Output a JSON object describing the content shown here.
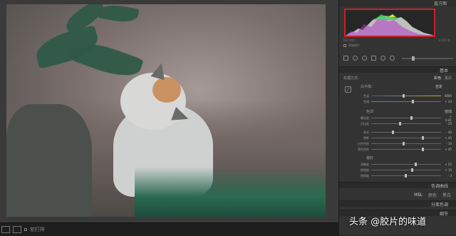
{
  "panel": {
    "header": "直方图",
    "histogram_info": {
      "left": "ISO 400",
      "right": "1/125 秒"
    },
    "original_photo": "原始照片",
    "sections": {
      "basic": "基本",
      "tone_curve": "色调曲线",
      "split_toning": "分离色调",
      "details": "细节"
    },
    "treatment": {
      "label": "处理方式：",
      "color": "彩色",
      "bw": "黑白"
    },
    "white_balance": {
      "label": "白平衡：",
      "value": "自定"
    },
    "temp": {
      "label": "色温",
      "value": "4800"
    },
    "tint": {
      "label": "色调",
      "value": "+ 24"
    },
    "tone_group": {
      "title": "色调",
      "auto": "自动"
    },
    "exposure": {
      "label": "曝光度",
      "value": "+ 0.41"
    },
    "contrast": {
      "label": "对比度",
      "value": "- 20"
    },
    "presence_group": {
      "title": "偏好"
    },
    "highlights": {
      "label": "高光",
      "value": "- 40"
    },
    "shadows": {
      "label": "阴影",
      "value": "+ 45"
    },
    "whites": {
      "label": "白色色阶",
      "value": "- 10"
    },
    "blacks": {
      "label": "黑色色阶",
      "value": "+ 45"
    },
    "clarity": {
      "label": "清晰度",
      "value": "+ 25"
    },
    "vibrance": {
      "label": "鲜艳度",
      "value": "+ 15"
    },
    "saturation": {
      "label": "饱和度",
      "value": "- 3"
    },
    "hsl_tabs": [
      "HSL",
      "颜色",
      "黑白"
    ]
  },
  "filmstrip": {
    "label": "软打样"
  },
  "watermark": "头条 @胶片的味道",
  "colors": {
    "accent_red": "#c8212b",
    "panel_bg": "#333333"
  }
}
